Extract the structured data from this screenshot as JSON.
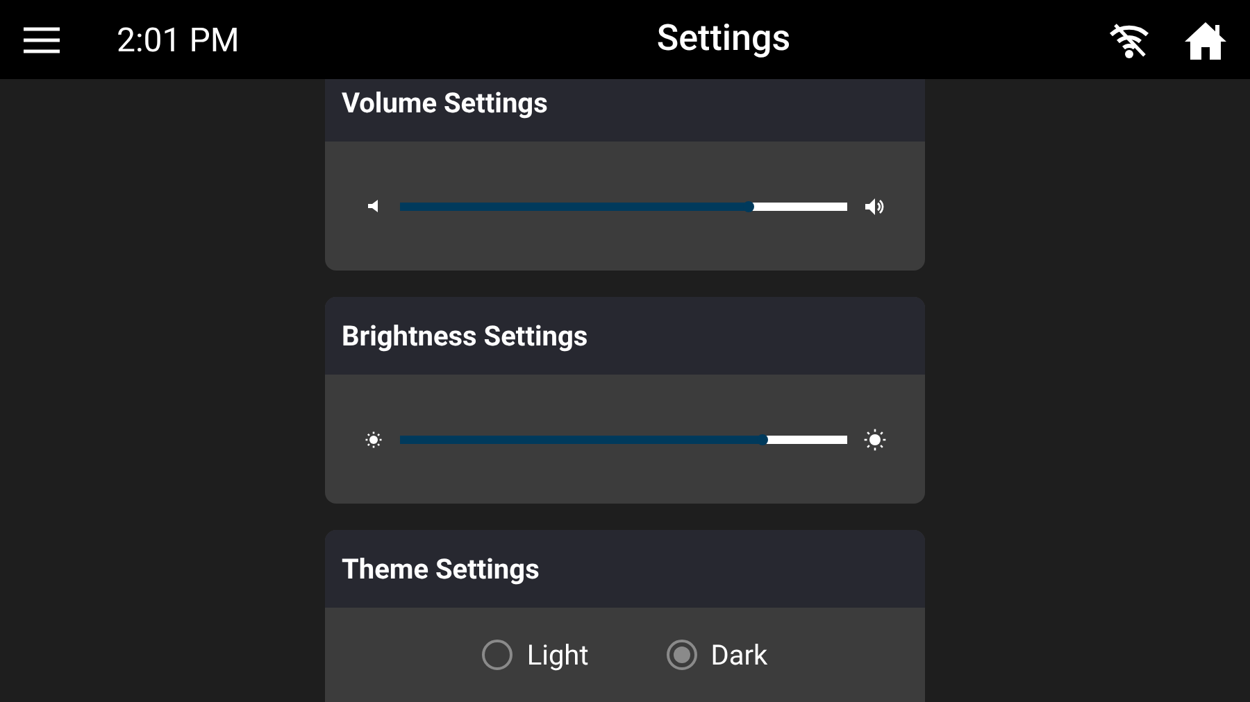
{
  "header": {
    "time": "2:01 PM",
    "title": "Settings"
  },
  "sections": [
    {
      "kind": "volume",
      "title": "Volume Settings",
      "level": 0.78
    },
    {
      "kind": "brightness",
      "title": "Brightness Settings",
      "level": 0.81
    },
    {
      "kind": "theme",
      "title": "Theme Settings",
      "options": [
        {
          "label": "Light",
          "selected": false
        },
        {
          "label": "Dark",
          "selected": true
        }
      ]
    }
  ]
}
